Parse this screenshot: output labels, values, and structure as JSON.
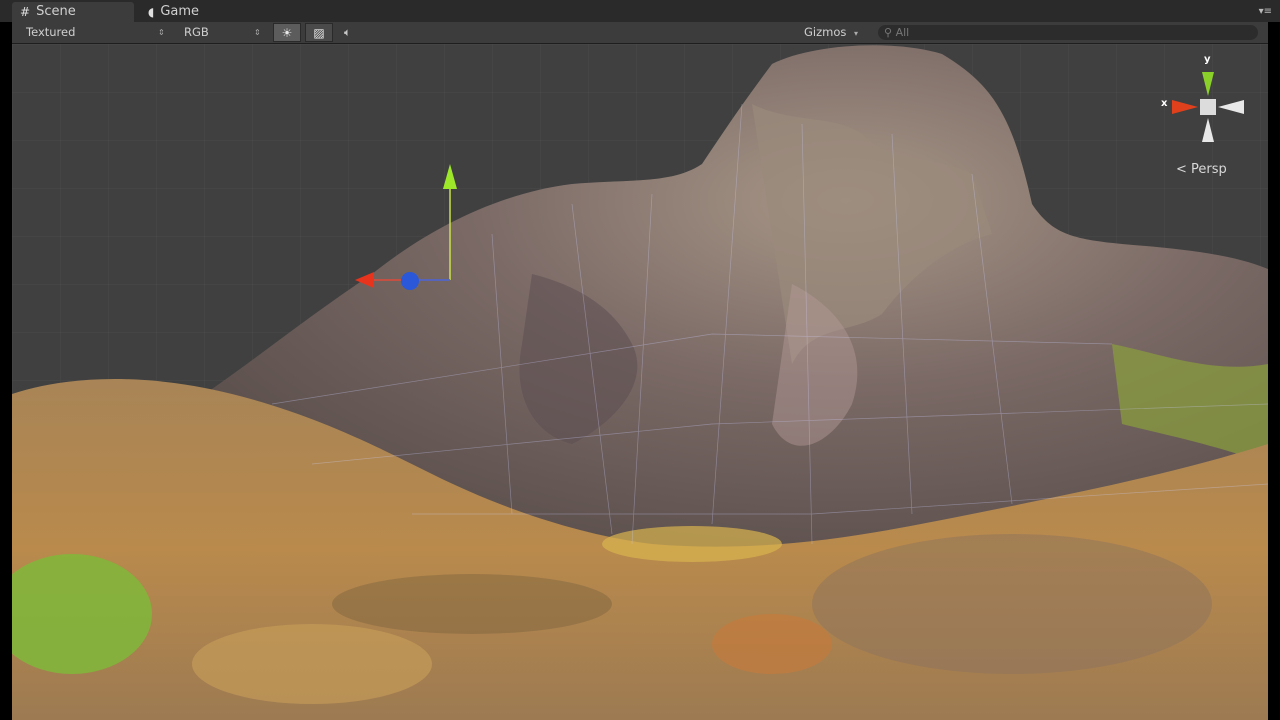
{
  "tabs": [
    {
      "label": "Scene",
      "icon": "grid-icon",
      "active": true
    },
    {
      "label": "Game",
      "icon": "pacman-icon",
      "active": false
    }
  ],
  "toolbar": {
    "draw_mode": "Textured",
    "render_mode": "RGB",
    "lighting_icon": "sun-icon",
    "skybox_icon": "image-icon",
    "audio_icon": "speaker-icon",
    "gizmos_label": "Gizmos",
    "search_placeholder": "All"
  },
  "scene_gizmo": {
    "projection_label": "Persp",
    "x_label": "x",
    "y_label": "y",
    "x_color": "#e0401c",
    "y_color": "#8ad12a",
    "z_color": "#3060e0"
  },
  "colors": {
    "editor_bg": "#3c3c3c",
    "viewport_bg": "#404040",
    "rock": "#7a6a62",
    "ground": "#b78a4a",
    "moss": "#7fb83a"
  }
}
